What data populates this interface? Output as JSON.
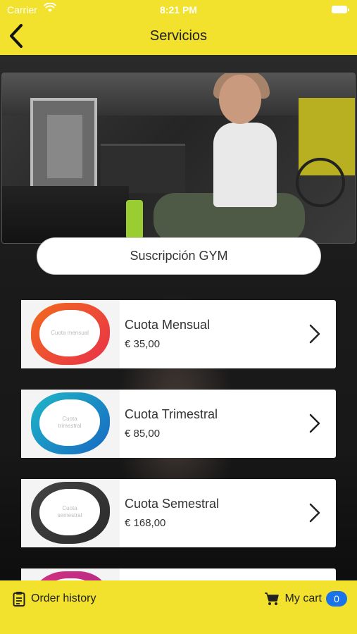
{
  "status_bar": {
    "carrier": "Carrier",
    "time": "8:21 PM"
  },
  "nav": {
    "title": "Servicios"
  },
  "pill": {
    "label": "Suscripción GYM"
  },
  "products": [
    {
      "name": "Cuota Mensual",
      "price": "€ 35,00",
      "thumb_text": "Cuota mensual",
      "color_start": "#f26b1d",
      "color_end": "#e8304a"
    },
    {
      "name": "Cuota Trimestral",
      "price": "€ 85,00",
      "thumb_text": "Cuota trimestral",
      "color_start": "#1fb7c7",
      "color_end": "#1867c2"
    },
    {
      "name": "Cuota Semestral",
      "price": "€ 168,00",
      "thumb_text": "Cuota semestral",
      "color_start": "#444444",
      "color_end": "#2a2a2a"
    },
    {
      "name": "",
      "price": "",
      "thumb_text": "",
      "color_start": "#d6307c",
      "color_end": "#a1288f"
    }
  ],
  "toolbar": {
    "orders_label": "Order history",
    "cart_label": "My cart",
    "cart_count": "0"
  },
  "colors": {
    "accent_yellow": "#f2e12d",
    "badge_blue": "#1a73e8"
  }
}
